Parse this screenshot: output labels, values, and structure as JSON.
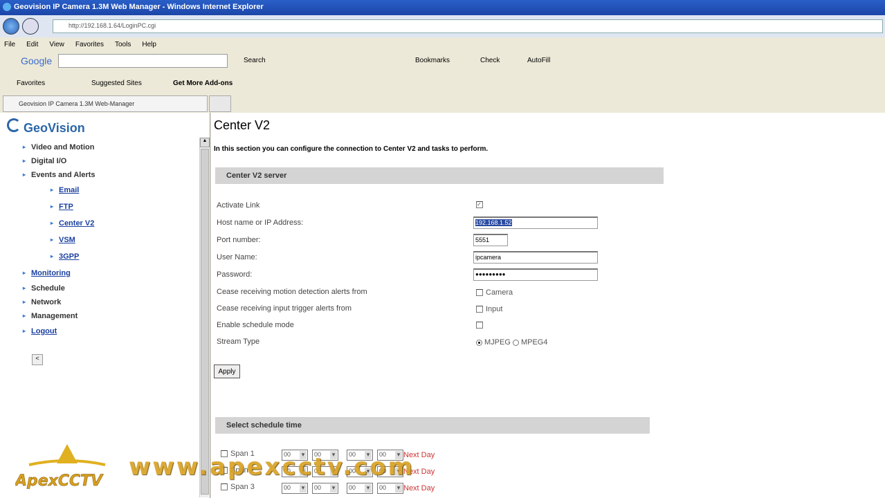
{
  "window": {
    "title": "Geovision IP Camera 1.3M Web Manager - Windows Internet Explorer",
    "url": "http://192.168.1.64/LoginPC.cgi"
  },
  "menu": [
    "File",
    "Edit",
    "View",
    "Favorites",
    "Tools",
    "Help"
  ],
  "google_bar": {
    "brand": "Google",
    "search": "Search",
    "bookmarks": "Bookmarks",
    "check": "Check",
    "autofill": "AutoFill"
  },
  "favorites_bar": {
    "favorites": "Favorites",
    "suggested": "Suggested Sites",
    "addons": "Get More Add-ons"
  },
  "tab": {
    "label": "Geovision IP Camera 1.3M Web-Manager"
  },
  "sidebar": {
    "logo": "GeoVision",
    "items": [
      {
        "label": "Video and Motion"
      },
      {
        "label": "Digital I/O"
      },
      {
        "label": "Events and Alerts"
      },
      {
        "label": "Email"
      },
      {
        "label": "FTP"
      },
      {
        "label": "Center V2"
      },
      {
        "label": "VSM"
      },
      {
        "label": "3GPP"
      },
      {
        "label": "Monitoring"
      },
      {
        "label": "Schedule"
      },
      {
        "label": "Network"
      },
      {
        "label": "Management"
      },
      {
        "label": "Logout"
      }
    ],
    "back": "<"
  },
  "main": {
    "title": "Center V2",
    "description": "In this section you can configure the connection to Center V2 and tasks to perform.",
    "section1": "Center V2 server",
    "fields": {
      "activate": "Activate Link",
      "host": "Host name or IP Address:",
      "port": "Port number:",
      "user": "User Name:",
      "password": "Password:",
      "cease_motion": "Cease receiving motion detection alerts from",
      "cease_input": "Cease receiving input trigger alerts from",
      "schedule": "Enable schedule mode",
      "stream": "Stream Type"
    },
    "values": {
      "host": "192.168.1.52",
      "port": "5551",
      "user": "ipcamera",
      "password": "●●●●●●●●●",
      "camera": "Camera",
      "input": "Input",
      "mjpeg": "MJPEG",
      "mpeg4": "MPEG4"
    },
    "apply": "Apply",
    "section2": "Select schedule time",
    "spans": [
      {
        "label": "Span 1",
        "v": [
          "00",
          "00",
          "00",
          "00"
        ],
        "next": "Next Day"
      },
      {
        "label": "Span 2",
        "v": [
          "00",
          "00",
          "00",
          "00"
        ],
        "next": "Next Day"
      },
      {
        "label": "Span 3",
        "v": [
          "00",
          "00",
          "00",
          "00"
        ],
        "next": "Next Day"
      }
    ]
  },
  "watermark": {
    "url": "www.apexcctv.com",
    "logo": "ApexCCTV"
  }
}
